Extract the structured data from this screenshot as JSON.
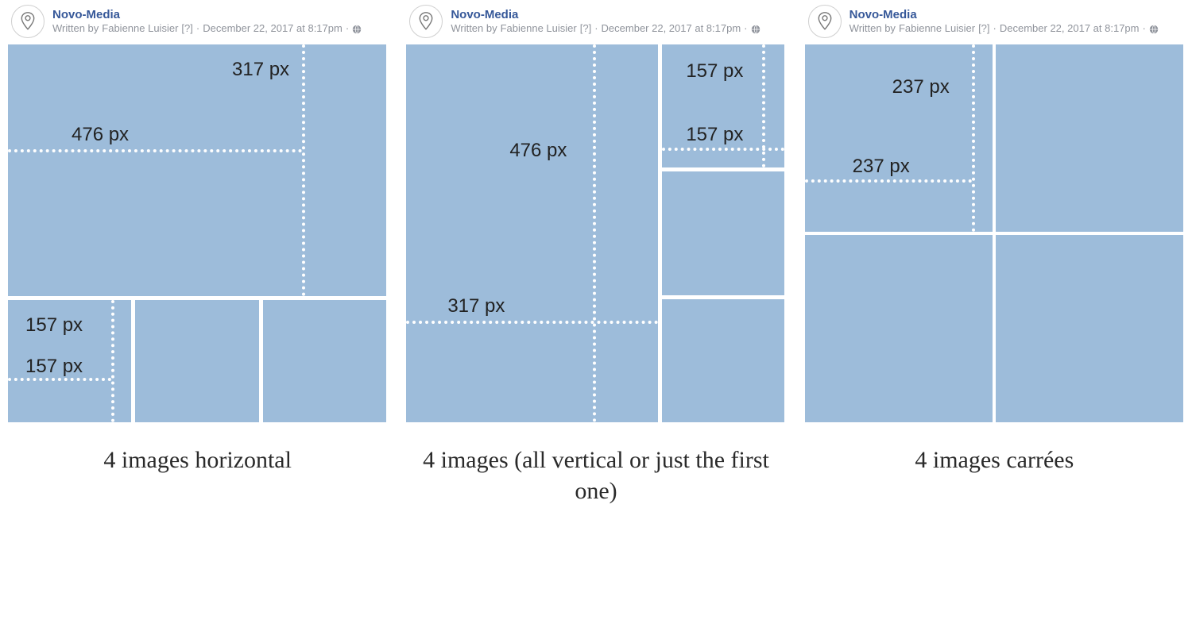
{
  "header": {
    "page_name": "Novo-Media",
    "byline_prefix": "Written by",
    "author": "Fabienne Luisier",
    "author_badge": "[?]",
    "separator": "·",
    "timestamp": "December 22, 2017 at 8:17pm",
    "avatar_label": "novo"
  },
  "layouts": [
    {
      "id": "horizontal",
      "caption": "4 images horizontal",
      "main": {
        "w_label": "476 px",
        "h_label": "317 px"
      },
      "thumb": {
        "w_label": "157 px",
        "h_label": "157 px"
      }
    },
    {
      "id": "vertical",
      "caption": "4 images (all vertical or just the first one)",
      "main": {
        "w_label": "317 px",
        "h_label": "476 px"
      },
      "thumb": {
        "w_label": "157 px",
        "h_label": "157 px"
      }
    },
    {
      "id": "square",
      "caption": "4 images carrées",
      "main": {
        "w_label": "237 px",
        "h_label": "237 px"
      }
    }
  ],
  "colors": {
    "tile": "#9dbcda",
    "link": "#365899",
    "muted": "#90949c"
  }
}
